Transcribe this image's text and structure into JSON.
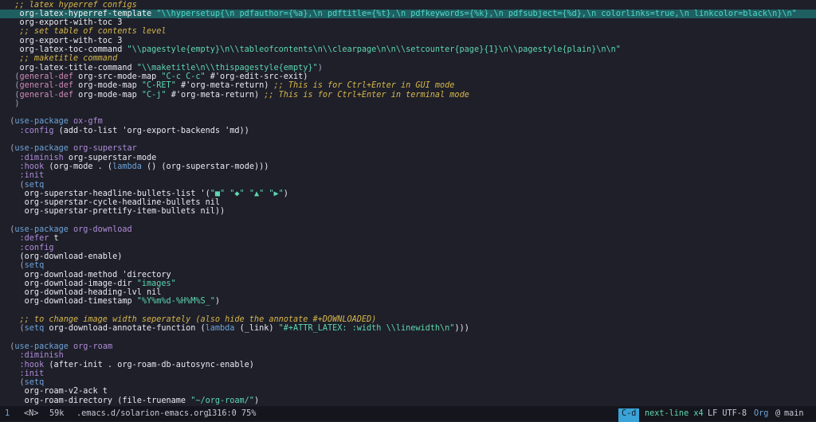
{
  "editor": {
    "lines": [
      {
        "highlight": false,
        "segments": [
          [
            "   ;; latex hyperref configs",
            "comment"
          ]
        ]
      },
      {
        "highlight": true,
        "segments": [
          [
            "    org-latex-hyperref-template ",
            "default"
          ],
          [
            "\"\\\\hypersetup{\\n pdfauthor={%a},\\n pdftitle={%t},\\n pdfkeywords={%k},\\n pdfsubject={%d},\\n colorlinks=true,\\n linkcolor=black\\n}\\n\"",
            "string"
          ]
        ]
      },
      {
        "highlight": false,
        "segments": [
          [
            "    org-export-with-toc 3",
            "default"
          ]
        ]
      },
      {
        "highlight": false,
        "segments": [
          [
            "    ;; set table of contents level",
            "comment"
          ]
        ]
      },
      {
        "highlight": false,
        "segments": [
          [
            "    org-export-with-toc 3",
            "default"
          ]
        ]
      },
      {
        "highlight": false,
        "segments": [
          [
            "    org-latex-toc-command ",
            "default"
          ],
          [
            "\"\\\\pagestyle{empty}\\n\\\\tableofcontents\\n\\\\clearpage\\n\\n\\\\setcounter{page}{1}\\n\\\\pagestyle{plain}\\n\\n\"",
            "string"
          ]
        ]
      },
      {
        "highlight": false,
        "segments": [
          [
            "    ;; maketitle command",
            "comment"
          ]
        ]
      },
      {
        "highlight": false,
        "segments": [
          [
            "    org-latex-title-command ",
            "default"
          ],
          [
            "\"\\\\maketitle\\n\\\\thispagestyle{empty}\"",
            "string"
          ],
          [
            ")",
            "paren"
          ]
        ]
      },
      {
        "highlight": false,
        "segments": [
          [
            "   (",
            "paren"
          ],
          [
            "general-def",
            "builtin"
          ],
          [
            " org-src-mode-map ",
            "default"
          ],
          [
            "\"C-c C-c\"",
            "string"
          ],
          [
            " #'org-edit-src-exit)",
            "default"
          ]
        ]
      },
      {
        "highlight": false,
        "segments": [
          [
            "   (",
            "paren"
          ],
          [
            "general-def",
            "builtin"
          ],
          [
            " org-mode-map ",
            "default"
          ],
          [
            "\"C-RET\"",
            "string"
          ],
          [
            " #'org-meta-return) ",
            "default"
          ],
          [
            ";; This is for Ctrl+Enter in GUI mode",
            "comment"
          ]
        ]
      },
      {
        "highlight": false,
        "segments": [
          [
            "   (",
            "paren"
          ],
          [
            "general-def",
            "builtin"
          ],
          [
            " org-mode-map ",
            "default"
          ],
          [
            "\"C-j\"",
            "string"
          ],
          [
            " #'org-meta-return) ",
            "default"
          ],
          [
            ";; This is for Ctrl+Enter in terminal mode",
            "comment"
          ]
        ]
      },
      {
        "highlight": false,
        "segments": [
          [
            "   )",
            "paren"
          ]
        ]
      },
      {
        "highlight": false,
        "segments": [
          [
            "",
            "default"
          ]
        ]
      },
      {
        "highlight": false,
        "segments": [
          [
            "  (",
            "paren"
          ],
          [
            "use-package",
            "macro"
          ],
          [
            " ",
            "default"
          ],
          [
            "ox-gfm",
            "keyword"
          ]
        ]
      },
      {
        "highlight": false,
        "segments": [
          [
            "    :config",
            "keyword"
          ],
          [
            " (add-to-list 'org-export-backends 'md))",
            "default"
          ]
        ]
      },
      {
        "highlight": false,
        "segments": [
          [
            "",
            "default"
          ]
        ]
      },
      {
        "highlight": false,
        "segments": [
          [
            "  (",
            "paren"
          ],
          [
            "use-package",
            "macro"
          ],
          [
            " ",
            "default"
          ],
          [
            "org-superstar",
            "keyword"
          ]
        ]
      },
      {
        "highlight": false,
        "segments": [
          [
            "    :diminish",
            "keyword"
          ],
          [
            " org-superstar-mode",
            "default"
          ]
        ]
      },
      {
        "highlight": false,
        "segments": [
          [
            "    :hook",
            "keyword"
          ],
          [
            " (org-mode . (",
            "default"
          ],
          [
            "lambda",
            "macro"
          ],
          [
            " () (org-superstar-mode)))",
            "default"
          ]
        ]
      },
      {
        "highlight": false,
        "segments": [
          [
            "    :init",
            "keyword"
          ]
        ]
      },
      {
        "highlight": false,
        "segments": [
          [
            "    (",
            "paren"
          ],
          [
            "setq",
            "macro"
          ]
        ]
      },
      {
        "highlight": false,
        "segments": [
          [
            "     org-superstar-headline-bullets-list '(",
            "default"
          ],
          [
            "\"■\" \"◆\" \"▲\" \"▶\"",
            "string"
          ],
          [
            ")",
            "default"
          ]
        ]
      },
      {
        "highlight": false,
        "segments": [
          [
            "     org-superstar-cycle-headline-bullets nil",
            "default"
          ]
        ]
      },
      {
        "highlight": false,
        "segments": [
          [
            "     org-superstar-prettify-item-bullets nil))",
            "default"
          ]
        ]
      },
      {
        "highlight": false,
        "segments": [
          [
            "",
            "default"
          ]
        ]
      },
      {
        "highlight": false,
        "segments": [
          [
            "  (",
            "paren"
          ],
          [
            "use-package",
            "macro"
          ],
          [
            " ",
            "default"
          ],
          [
            "org-download",
            "keyword"
          ]
        ]
      },
      {
        "highlight": false,
        "segments": [
          [
            "    :defer",
            "keyword"
          ],
          [
            " t",
            "default"
          ]
        ]
      },
      {
        "highlight": false,
        "segments": [
          [
            "    :config",
            "keyword"
          ]
        ]
      },
      {
        "highlight": false,
        "segments": [
          [
            "    (org-download-enable)",
            "default"
          ]
        ]
      },
      {
        "highlight": false,
        "segments": [
          [
            "    (",
            "paren"
          ],
          [
            "setq",
            "macro"
          ]
        ]
      },
      {
        "highlight": false,
        "segments": [
          [
            "     org-download-method 'directory",
            "default"
          ]
        ]
      },
      {
        "highlight": false,
        "segments": [
          [
            "     org-download-image-dir ",
            "default"
          ],
          [
            "\"images\"",
            "string"
          ]
        ]
      },
      {
        "highlight": false,
        "segments": [
          [
            "     org-download-heading-lvl nil",
            "default"
          ]
        ]
      },
      {
        "highlight": false,
        "segments": [
          [
            "     org-download-timestamp ",
            "default"
          ],
          [
            "\"%Y%m%d-%H%M%S_\"",
            "string"
          ],
          [
            ")",
            "default"
          ]
        ]
      },
      {
        "highlight": false,
        "segments": [
          [
            "",
            "default"
          ]
        ]
      },
      {
        "highlight": false,
        "segments": [
          [
            "    ;; to change image width seperately (also hide the annotate #+DOWNLOADED)",
            "comment"
          ]
        ]
      },
      {
        "highlight": false,
        "segments": [
          [
            "    (",
            "paren"
          ],
          [
            "setq",
            "macro"
          ],
          [
            " org-download-annotate-function (",
            "default"
          ],
          [
            "lambda",
            "macro"
          ],
          [
            " (_link) ",
            "default"
          ],
          [
            "\"#+ATTR_LATEX: :width \\\\linewidth\\n\"",
            "string"
          ],
          [
            ")))",
            "default"
          ]
        ]
      },
      {
        "highlight": false,
        "segments": [
          [
            "",
            "default"
          ]
        ]
      },
      {
        "highlight": false,
        "segments": [
          [
            "  (",
            "paren"
          ],
          [
            "use-package",
            "macro"
          ],
          [
            " ",
            "default"
          ],
          [
            "org-roam",
            "keyword"
          ]
        ]
      },
      {
        "highlight": false,
        "segments": [
          [
            "    :diminish",
            "keyword"
          ]
        ]
      },
      {
        "highlight": false,
        "segments": [
          [
            "    :hook",
            "keyword"
          ],
          [
            " (after-init . org-roam-db-autosync-enable)",
            "default"
          ]
        ]
      },
      {
        "highlight": false,
        "segments": [
          [
            "    :init",
            "keyword"
          ]
        ]
      },
      {
        "highlight": false,
        "segments": [
          [
            "    (",
            "paren"
          ],
          [
            "setq",
            "macro"
          ]
        ]
      },
      {
        "highlight": false,
        "segments": [
          [
            "     org-roam-v2-ack t",
            "default"
          ]
        ]
      },
      {
        "highlight": false,
        "segments": [
          [
            "     org-roam-directory (file-truename ",
            "default"
          ],
          [
            "\"~/org-roam/\"",
            "string"
          ],
          [
            ")",
            "default"
          ]
        ]
      }
    ]
  },
  "modeline": {
    "window_number": "1",
    "evil_state": "<N>",
    "buffer_size": "59k",
    "file_path": ".emacs.d/solarion-emacs.org",
    "position": "1316:0 75%",
    "keychord": "C-d",
    "command": "next-line x4",
    "encoding": "LF UTF-8",
    "major_mode": "Org",
    "branch_icon": "@",
    "branch": "main"
  },
  "colors": {
    "background": "#1e1f29",
    "highlight_line": "#1f5f62",
    "comment": "#d7b74a",
    "string": "#5fd7b0",
    "keyword": "#b08cd9",
    "macro": "#6fa3d8",
    "builtin": "#d08ab6",
    "modeline_bg": "#15161d",
    "keychord_bg": "#3aa3d8"
  }
}
